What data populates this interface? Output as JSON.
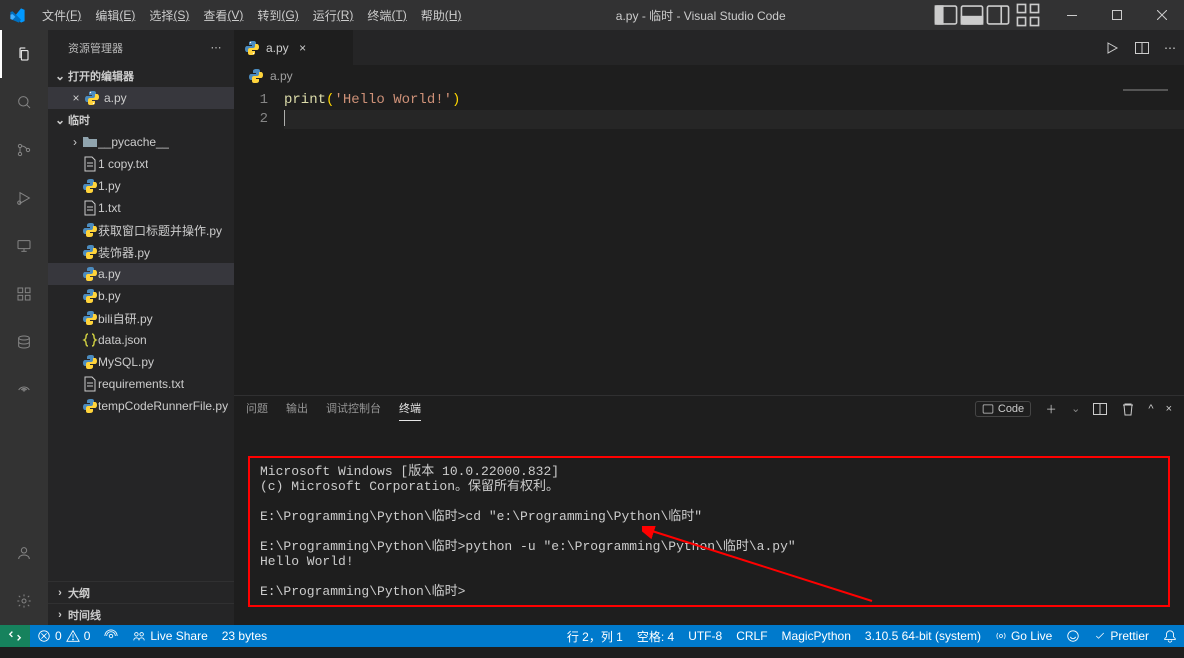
{
  "titlebar": {
    "menu": [
      {
        "l": "文件",
        "u": "(F)"
      },
      {
        "l": "编辑",
        "u": "(E)"
      },
      {
        "l": "选择",
        "u": "(S)"
      },
      {
        "l": "查看",
        "u": "(V)"
      },
      {
        "l": "转到",
        "u": "(G)"
      },
      {
        "l": "运行",
        "u": "(R)"
      },
      {
        "l": "终端",
        "u": "(T)"
      },
      {
        "l": "帮助",
        "u": "(H)"
      }
    ],
    "title": "a.py - 临时 - Visual Studio Code"
  },
  "sidebar": {
    "header": "资源管理器",
    "open_editors_label": "打开的编辑器",
    "open_editor_file": "a.py",
    "workspace_label": "临时",
    "outline_label": "大纲",
    "timeline_label": "时间线",
    "tree": [
      {
        "indent": 1,
        "type": "folder-closed",
        "label": "__pycache__"
      },
      {
        "indent": 1,
        "type": "txt",
        "label": "1 copy.txt"
      },
      {
        "indent": 1,
        "type": "py",
        "label": "1.py"
      },
      {
        "indent": 1,
        "type": "txt",
        "label": "1.txt"
      },
      {
        "indent": 1,
        "type": "py",
        "label": "获取窗口标题并操作.py"
      },
      {
        "indent": 1,
        "type": "py",
        "label": "装饰器.py"
      },
      {
        "indent": 1,
        "type": "py",
        "label": "a.py",
        "selected": true
      },
      {
        "indent": 1,
        "type": "py",
        "label": "b.py"
      },
      {
        "indent": 1,
        "type": "py",
        "label": "bili自研.py"
      },
      {
        "indent": 1,
        "type": "json",
        "label": "data.json"
      },
      {
        "indent": 1,
        "type": "py",
        "label": "MySQL.py"
      },
      {
        "indent": 1,
        "type": "txt",
        "label": "requirements.txt"
      },
      {
        "indent": 1,
        "type": "py",
        "label": "tempCodeRunnerFile.py"
      }
    ]
  },
  "editor": {
    "tab_name": "a.py",
    "breadcrumb_file": "a.py",
    "lines": [
      {
        "n": "1",
        "tokens": [
          {
            "t": "print",
            "c": "fn"
          },
          {
            "t": "(",
            "c": "par"
          },
          {
            "t": "'Hello World!'",
            "c": "str"
          },
          {
            "t": ")",
            "c": "par"
          }
        ]
      },
      {
        "n": "2",
        "tokens": [],
        "current": true
      }
    ]
  },
  "panel": {
    "tabs": [
      "问题",
      "输出",
      "调试控制台",
      "终端"
    ],
    "active_tab_index": 3,
    "code_label": "Code",
    "terminal_lines": [
      "Microsoft Windows [版本 10.0.22000.832]",
      "(c) Microsoft Corporation。保留所有权利。",
      "",
      "E:\\Programming\\Python\\临时>cd \"e:\\Programming\\Python\\临时\"",
      "",
      "E:\\Programming\\Python\\临时>python -u \"e:\\Programming\\Python\\临时\\a.py\"",
      "Hello World!",
      "",
      "E:\\Programming\\Python\\临时>"
    ]
  },
  "statusbar": {
    "errors": "0",
    "warnings": "0",
    "liveshare": "Live Share",
    "filesize": "23 bytes",
    "cursor": "行 2，列 1",
    "spaces": "空格: 4",
    "encoding": "UTF-8",
    "eol": "CRLF",
    "language": "MagicPython",
    "python": "3.10.5 64-bit (system)",
    "golive": "Go Live",
    "prettier": "Prettier"
  }
}
